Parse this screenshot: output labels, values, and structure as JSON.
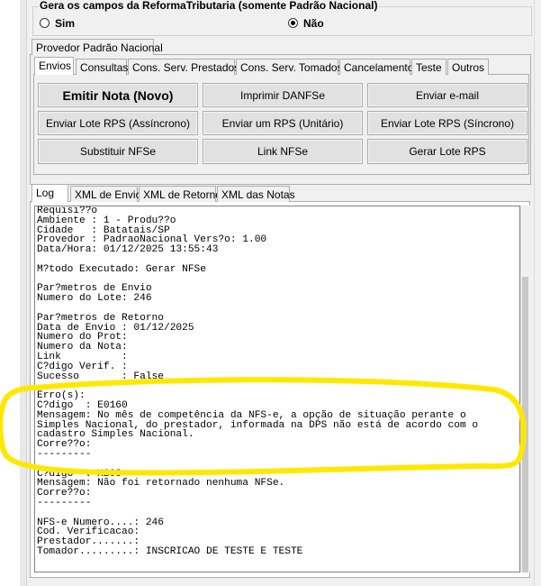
{
  "group": {
    "title": "Gera os campos da ReformaTributaria (somente Padrão Nacional)",
    "option_yes": "Sim",
    "option_no": "Não",
    "selected": "Não"
  },
  "provider_tab": "Provedor Padrão Nacional",
  "action_tabs": [
    "Envios",
    "Consultas",
    "Cons. Serv. Prestados",
    "Cons. Serv. Tomados",
    "Cancelamento",
    "Teste",
    "Outros"
  ],
  "buttons": {
    "emitir": "Emitir Nota (Novo)",
    "imprimir": "Imprimir DANFSe",
    "email": "Enviar e-mail",
    "lote_async": "Enviar Lote RPS (Assíncrono)",
    "rps_unit": "Enviar um RPS (Unitário)",
    "lote_sync": "Enviar Lote RPS (Síncrono)",
    "substituir": "Substituir NFSe",
    "link": "Link NFSe",
    "gerar_lote": "Gerar Lote RPS"
  },
  "log_tabs": [
    "Log",
    "XML de Envio",
    "XML de Retorno",
    "XML das Notas"
  ],
  "log_text": "Requisi??o\nAmbiente : 1 - Produ??o\nCidade   : Batatais/SP\nProvedor : PadraoNacional Vers?o: 1.00\nData/Hora: 01/12/2025 13:55:43\n\nM?todo Executado: Gerar NFSe\n\nPar?metros de Envio\nNumero do Lote: 246\n\nPar?metros de Retorno\nData de Envio : 01/12/2025\nNumero do Prot:\nNumero da Nota:\nLink          :\nC?digo Verif. :\nSucesso       : False\n\nErro(s):\nC?digo  : E0160\nMensagem: No mês de competência da NFS-e, a opção de situação perante o\nSimples Nacional, do prestador, informada na DPS não está de acordo com o\ncadastro Simples Nacional.\nCorre??o:\n---------\n\nC?digo  : X203\nMensagem: Não foi retornado nenhuma NFSe.\nCorre??o:\n---------\n\nNFS-e Numero....: 246\nCod. Verificacao:\nPrestador.......:\nTomador.........: INSCRICAO DE TESTE E TESTE",
  "colors": {
    "highlight": "#ffe800",
    "panel": "#f0f0f0",
    "button": "#e1e1e1"
  }
}
